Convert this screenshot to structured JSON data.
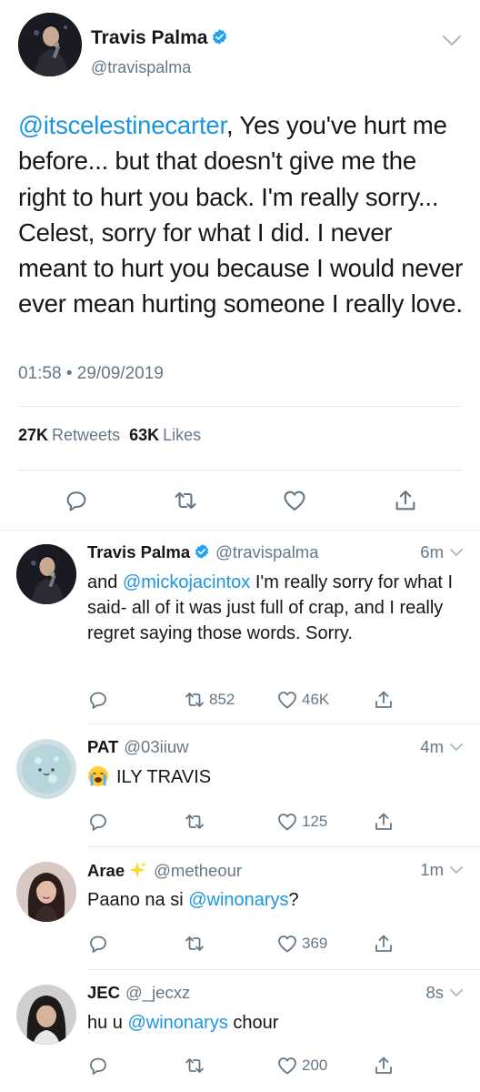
{
  "main_tweet": {
    "author_name": "Travis Palma",
    "author_handle": "@travispalma",
    "mention": "@itscelestinecarter",
    "body": ", Yes you've hurt me before... but that doesn't give me the right to hurt you back. I'm really sorry... Celest, sorry for what I did. I never meant to hurt you because I would never ever mean hurting someone I really love.",
    "timestamp": "01:58 • 29/09/2019",
    "retweets_count": "27K",
    "retweets_label": "Retweets",
    "likes_count": "63K",
    "likes_label": "Likes"
  },
  "replies": [
    {
      "name": "Travis Palma",
      "handle": "@travispalma",
      "time": "6m",
      "text_prefix": "and ",
      "mention": "@mickojacintox",
      "text_suffix": " I'm really sorry for what I said- all of it was just full of crap, and I really regret saying those words. Sorry.",
      "retweets": "852",
      "likes": "46K"
    },
    {
      "name": "PAT",
      "handle": "@03iiuw",
      "time": "4m",
      "text": "ILY TRAVIS",
      "likes": "125"
    },
    {
      "name": "Arae",
      "handle": "@metheour",
      "time": "1m",
      "text_prefix": "Paano na si ",
      "mention": "@winonarys",
      "text_suffix": "?",
      "likes": "369"
    },
    {
      "name": "JEC",
      "handle": "@_jecxz",
      "time": "8s",
      "text_prefix": "hu u ",
      "mention": "@winonarys",
      "text_suffix": " chour",
      "likes": "200"
    }
  ],
  "colors": {
    "link": "#1b95e0",
    "muted": "#657786",
    "divider": "#e1e8ed",
    "verified": "#1da1f2"
  },
  "icons": [
    "verified-badge-icon",
    "chevron-down-icon",
    "reply-icon",
    "retweet-icon",
    "like-icon",
    "share-icon",
    "sparkle-emoji-icon",
    "crying-face-emoji-icon"
  ]
}
